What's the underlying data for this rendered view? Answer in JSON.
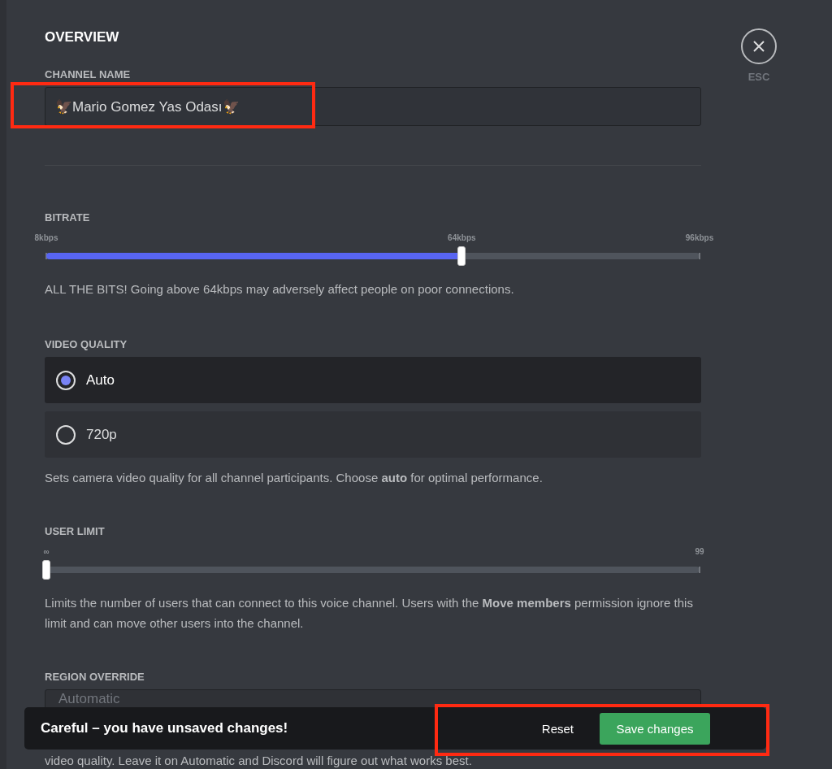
{
  "title": "OVERVIEW",
  "close": {
    "label": "ESC"
  },
  "channel_name": {
    "label": "CHANNEL NAME",
    "value": "🦅Mario Gomez Yas Odası🦅",
    "highlighted": true
  },
  "bitrate": {
    "label": "BITRATE",
    "level": 0.636,
    "ticks": [
      {
        "label": "8kbps",
        "kind": "start"
      },
      {
        "label": "64kbps",
        "kind": "thumb"
      },
      {
        "label": "96kbps",
        "kind": "end"
      }
    ],
    "description": "ALL THE BITS! Going above 64kbps may adversely affect people on poor connections."
  },
  "video_quality": {
    "label": "VIDEO QUALITY",
    "options": [
      {
        "label": "Auto",
        "selected": true
      },
      {
        "label": "720p",
        "selected": false
      }
    ],
    "description": "Sets camera video quality for all channel participants. Choose **auto** for optimal performance."
  },
  "user_limit": {
    "label": "USER LIMIT",
    "level": 0,
    "ticks": [
      {
        "label": "∞",
        "kind": "start"
      },
      {
        "label": "99",
        "kind": "end"
      }
    ],
    "description": "Limits the number of users that can connect to this voice channel. Users with the **Move members** permission ignore this limit and can move other users into the channel."
  },
  "region_override": {
    "label": "REGION OVERRIDE",
    "value": "Automatic",
    "description": "video quality. Leave it on Automatic and Discord will figure out what works best."
  },
  "notice": {
    "message": "Careful – you have unsaved changes!",
    "reset": "Reset",
    "save": "Save changes",
    "highlighted": true
  }
}
